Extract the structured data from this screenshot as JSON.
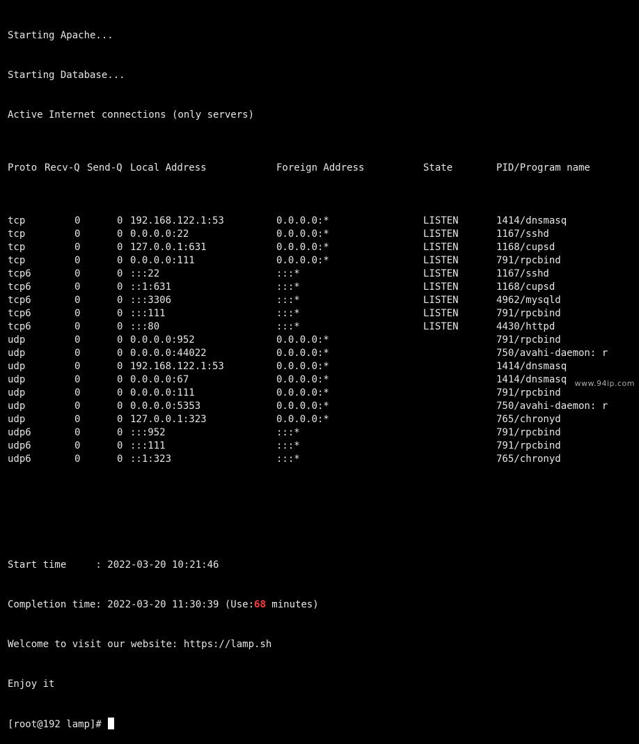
{
  "terminal": {
    "pre_lines": [
      "Starting Apache...",
      "Starting Database...",
      "Active Internet connections (only servers)"
    ],
    "headers": {
      "proto": "Proto",
      "recv": "Recv-Q",
      "send": "Send-Q",
      "local": "Local Address",
      "foreign": "Foreign Address",
      "state": "State",
      "pid": "PID/Program name"
    },
    "rows": [
      {
        "proto": "tcp",
        "recv": "0",
        "send": "0",
        "local": "192.168.122.1:53",
        "foreign": "0.0.0.0:*",
        "state": "LISTEN",
        "pid": "1414/dnsmasq"
      },
      {
        "proto": "tcp",
        "recv": "0",
        "send": "0",
        "local": "0.0.0.0:22",
        "foreign": "0.0.0.0:*",
        "state": "LISTEN",
        "pid": "1167/sshd"
      },
      {
        "proto": "tcp",
        "recv": "0",
        "send": "0",
        "local": "127.0.0.1:631",
        "foreign": "0.0.0.0:*",
        "state": "LISTEN",
        "pid": "1168/cupsd"
      },
      {
        "proto": "tcp",
        "recv": "0",
        "send": "0",
        "local": "0.0.0.0:111",
        "foreign": "0.0.0.0:*",
        "state": "LISTEN",
        "pid": "791/rpcbind"
      },
      {
        "proto": "tcp6",
        "recv": "0",
        "send": "0",
        "local": ":::22",
        "foreign": ":::*",
        "state": "LISTEN",
        "pid": "1167/sshd"
      },
      {
        "proto": "tcp6",
        "recv": "0",
        "send": "0",
        "local": "::1:631",
        "foreign": ":::*",
        "state": "LISTEN",
        "pid": "1168/cupsd"
      },
      {
        "proto": "tcp6",
        "recv": "0",
        "send": "0",
        "local": ":::3306",
        "foreign": ":::*",
        "state": "LISTEN",
        "pid": "4962/mysqld"
      },
      {
        "proto": "tcp6",
        "recv": "0",
        "send": "0",
        "local": ":::111",
        "foreign": ":::*",
        "state": "LISTEN",
        "pid": "791/rpcbind"
      },
      {
        "proto": "tcp6",
        "recv": "0",
        "send": "0",
        "local": ":::80",
        "foreign": ":::*",
        "state": "LISTEN",
        "pid": "4430/httpd"
      },
      {
        "proto": "udp",
        "recv": "0",
        "send": "0",
        "local": "0.0.0.0:952",
        "foreign": "0.0.0.0:*",
        "state": "",
        "pid": "791/rpcbind"
      },
      {
        "proto": "udp",
        "recv": "0",
        "send": "0",
        "local": "0.0.0.0:44022",
        "foreign": "0.0.0.0:*",
        "state": "",
        "pid": "750/avahi-daemon: r"
      },
      {
        "proto": "udp",
        "recv": "0",
        "send": "0",
        "local": "192.168.122.1:53",
        "foreign": "0.0.0.0:*",
        "state": "",
        "pid": "1414/dnsmasq"
      },
      {
        "proto": "udp",
        "recv": "0",
        "send": "0",
        "local": "0.0.0.0:67",
        "foreign": "0.0.0.0:*",
        "state": "",
        "pid": "1414/dnsmasq"
      },
      {
        "proto": "udp",
        "recv": "0",
        "send": "0",
        "local": "0.0.0.0:111",
        "foreign": "0.0.0.0:*",
        "state": "",
        "pid": "791/rpcbind"
      },
      {
        "proto": "udp",
        "recv": "0",
        "send": "0",
        "local": "0.0.0.0:5353",
        "foreign": "0.0.0.0:*",
        "state": "",
        "pid": "750/avahi-daemon: r"
      },
      {
        "proto": "udp",
        "recv": "0",
        "send": "0",
        "local": "127.0.0.1:323",
        "foreign": "0.0.0.0:*",
        "state": "",
        "pid": "765/chronyd"
      },
      {
        "proto": "udp6",
        "recv": "0",
        "send": "0",
        "local": ":::952",
        "foreign": ":::*",
        "state": "",
        "pid": "791/rpcbind"
      },
      {
        "proto": "udp6",
        "recv": "0",
        "send": "0",
        "local": ":::111",
        "foreign": ":::*",
        "state": "",
        "pid": "791/rpcbind"
      },
      {
        "proto": "udp6",
        "recv": "0",
        "send": "0",
        "local": "::1:323",
        "foreign": ":::*",
        "state": "",
        "pid": "765/chronyd"
      }
    ],
    "summary": {
      "start_line": "Start time     : 2022-03-20 10:21:46",
      "completion_prefix": "Completion time: 2022-03-20 11:30:39 (Use:",
      "completion_minutes": "68",
      "completion_suffix": " minutes)",
      "welcome_line": "Welcome to visit our website: https://lamp.sh",
      "enjoy_line": "Enjoy it"
    },
    "prompt": "[root@192 lamp]# ",
    "colors": {
      "background": "#000000",
      "text": "#e6e6e6",
      "accent": "#ff3b3b"
    }
  },
  "watermark": "www.94ip.com"
}
